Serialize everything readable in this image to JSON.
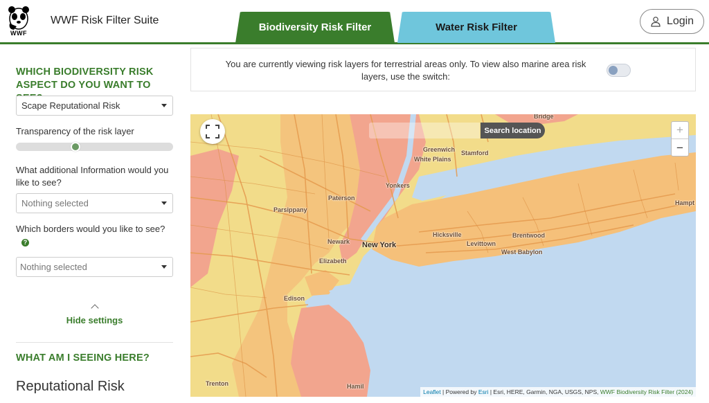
{
  "header": {
    "logo_text": "WWF",
    "app_title": "WWF Risk Filter Suite",
    "tabs": [
      {
        "label": "Biodiversity Risk Filter",
        "active": true
      },
      {
        "label": "Water Risk Filter",
        "active": false
      }
    ],
    "login_label": "Login"
  },
  "sidebar": {
    "heading": "WHICH BIODIVERSITY RISK ASPECT DO YOU WANT TO SEE?",
    "risk_select_value": "Scape Reputational Risk",
    "transparency_label": "Transparency of the risk layer",
    "transparency_value": 0.37,
    "additional_info_label": "What additional Information would you like to see?",
    "additional_info_value": "Nothing selected",
    "borders_label": "Which borders would you like to see?",
    "borders_value": "Nothing selected",
    "help_icon": "?",
    "hide_settings_label": "Hide settings",
    "what_heading": "WHAT AM I SEEING HERE?",
    "section_title": "Reputational Risk"
  },
  "notice": {
    "text": "You are currently viewing risk layers for terrestrial areas only. To view also marine area risk layers, use the switch:",
    "switch_on": false
  },
  "map": {
    "search_button_label": "Search location",
    "zoom_in": "+",
    "zoom_out": "−",
    "places": {
      "bridgeport": "Bridge",
      "greenwich": "Greenwich",
      "stamford": "Stamford",
      "white_plains": "White Plains",
      "yonkers": "Yonkers",
      "paterson": "Paterson",
      "parsippany": "Parsippany",
      "newark": "Newark",
      "new_york": "New York",
      "elizabeth": "Elizabeth",
      "hicksville": "Hicksville",
      "levittown": "Levittown",
      "brentwood": "Brentwood",
      "west_babylon": "West Babylon",
      "hampton": "Hampt",
      "edison": "Edison",
      "trenton": "Trenton",
      "hamilton": "Hamil"
    },
    "attribution": {
      "leaflet": "Leaflet",
      "sep1": " | Powered by ",
      "esri": "Esri",
      "sources": " | Esri, HERE, Garmin, NGA, USGS, NPS, ",
      "wwf": "WWF Biodiversity Risk Filter (2024)"
    }
  },
  "colors": {
    "brand_green": "#3a7d2c",
    "water_tab": "#6fc6dc",
    "risk_low": "#f2dc8a",
    "risk_medium": "#f5c07a",
    "risk_high": "#f2a58e",
    "water": "#c1d9f0"
  }
}
